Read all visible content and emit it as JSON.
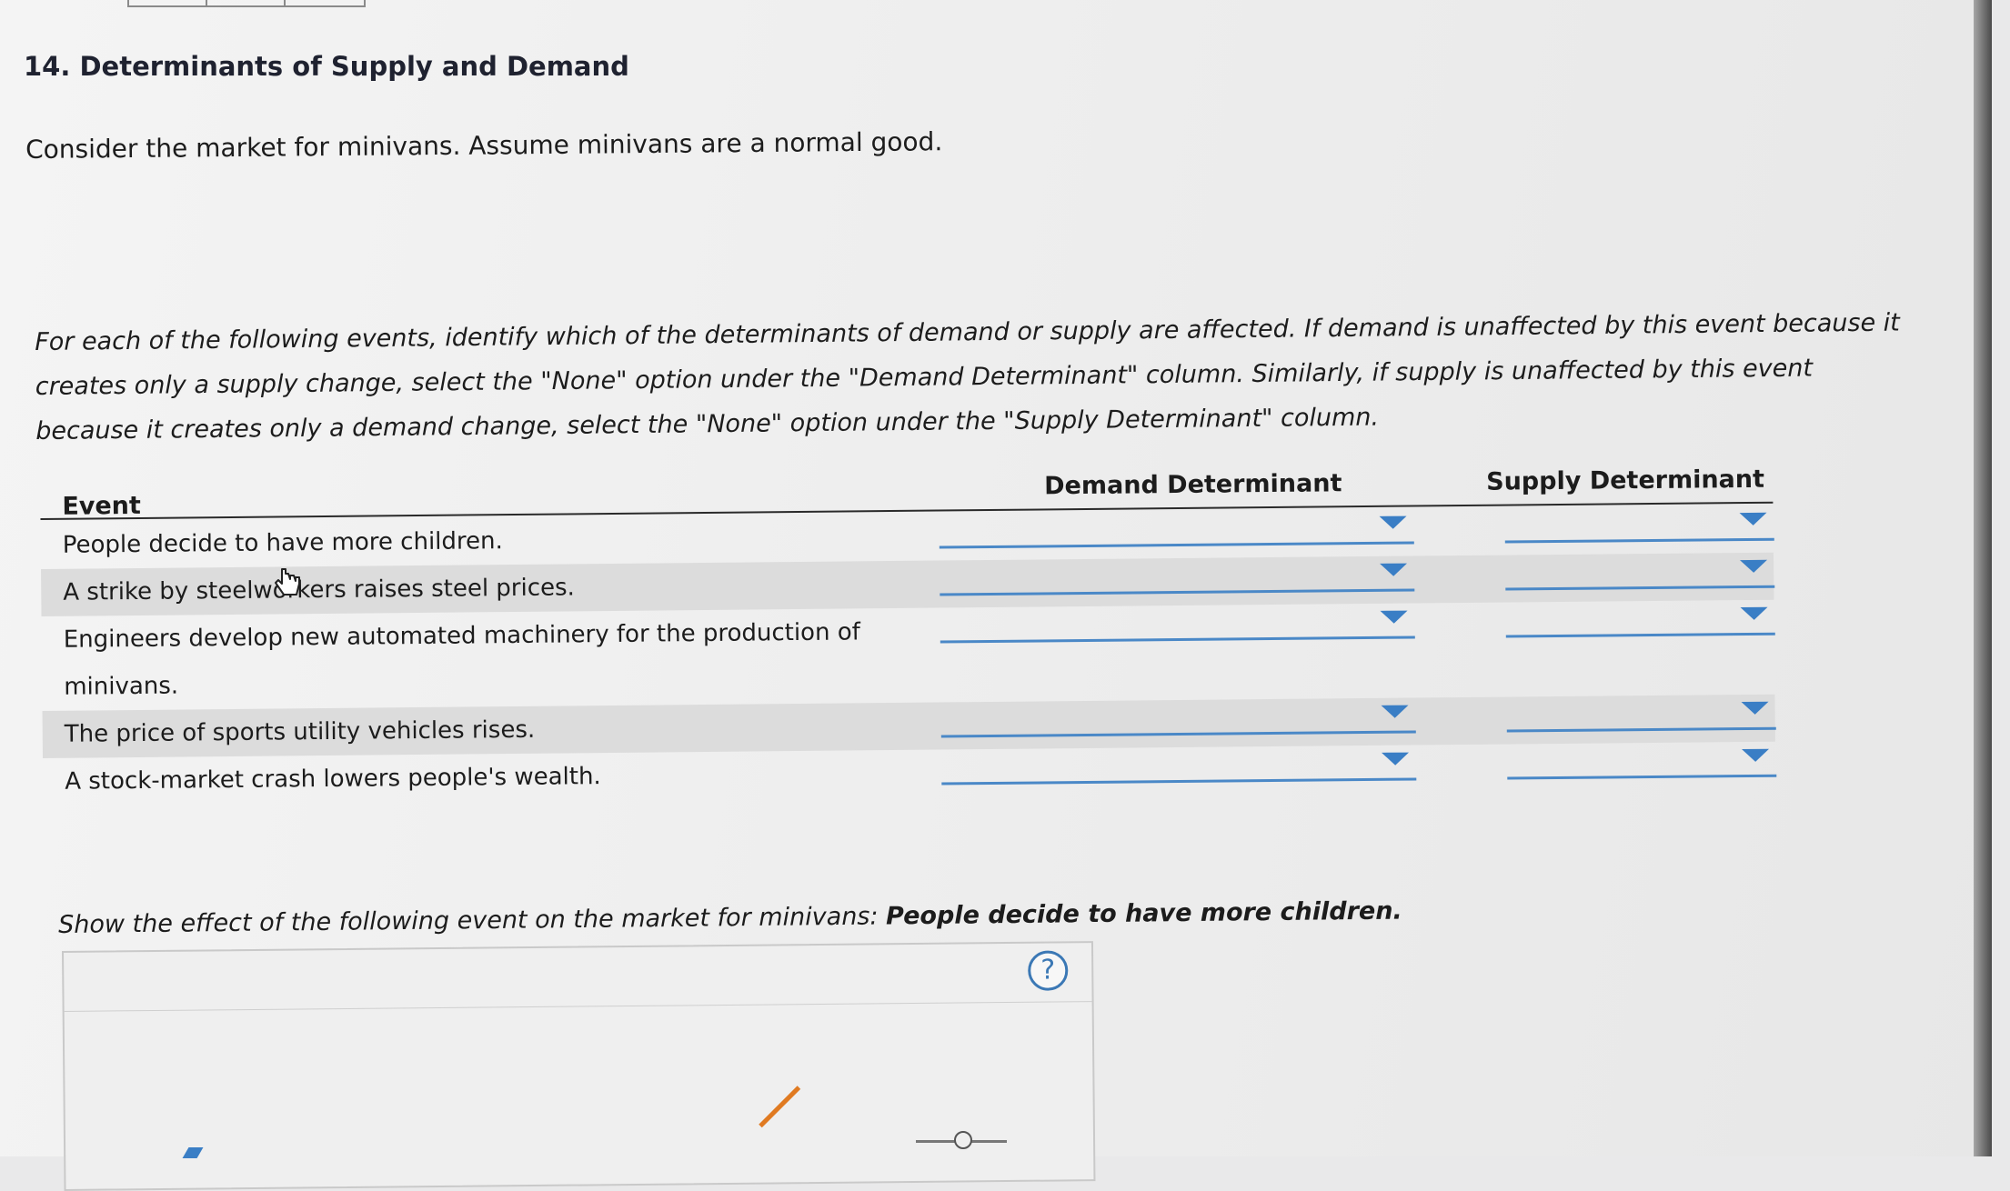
{
  "question": {
    "title": "14. Determinants of Supply and Demand",
    "intro": "Consider the market for minivans. Assume minivans are a normal good.",
    "instructions": [
      "For each of the following events, identify which of the determinants of demand or supply are affected. If demand is unaffected by this event because it",
      "creates only a supply change, select the \"None\" option under the \"Demand Determinant\" column. Similarly, if supply is unaffected by this event",
      "because it creates only a demand change, select the \"None\" option under the \"Supply Determinant\" column."
    ]
  },
  "table": {
    "headers": {
      "event": "Event",
      "demand": "Demand Determinant",
      "supply": "Supply Determinant"
    },
    "rows": [
      {
        "event": [
          "People decide to have more children."
        ],
        "demand": "",
        "supply": ""
      },
      {
        "event": [
          "A strike by steelworkers raises steel prices."
        ],
        "demand": "",
        "supply": ""
      },
      {
        "event": [
          "Engineers develop new automated machinery for the production of",
          "minivans."
        ],
        "demand": "",
        "supply": ""
      },
      {
        "event": [
          "The price of sports utility vehicles rises."
        ],
        "demand": "",
        "supply": ""
      },
      {
        "event": [
          "A stock-market crash lowers people's wealth."
        ],
        "demand": "",
        "supply": ""
      }
    ]
  },
  "graph_prompt": {
    "lead": "Show the effect of the following event on the market for minivans:",
    "event": "People decide to have more children."
  },
  "help": {
    "label": "?"
  },
  "icons": {
    "dropdown": "chevron-down-icon",
    "help": "question-mark-icon",
    "cursor": "hand-pointer-icon"
  },
  "colors": {
    "accent": "#3a7ec5",
    "shade": "#dcdcdc",
    "orange": "#e07a21"
  }
}
